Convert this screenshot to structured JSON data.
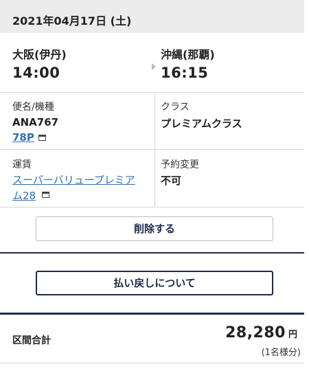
{
  "header": {
    "date": "2021年04月17日 (土)"
  },
  "flight": {
    "departure": {
      "city": "大阪(伊丹)",
      "time": "14:00"
    },
    "arrival": {
      "city": "沖縄(那覇)",
      "time": "16:15"
    }
  },
  "flight_info": {
    "flight_label": "便名/機種",
    "flight_number": "ANA767",
    "aircraft": "78P",
    "class_label": "クラス",
    "class_value": "プレミアムクラス"
  },
  "fare_info": {
    "fare_label": "運賃",
    "fare_name_line1": "スーパーバリュープレミア",
    "fare_name_line2": "ム28",
    "change_label": "予約変更",
    "change_value": "不可"
  },
  "actions": {
    "delete_label": "削除する",
    "refund_label": "払い戻しについて"
  },
  "total": {
    "label": "区間合計",
    "amount": "28,280",
    "unit": "円",
    "note": "(1名様分)"
  },
  "colors": {
    "link": "#2f6fb6",
    "navy": "#1e2a4a",
    "header_bg": "#ececec"
  }
}
